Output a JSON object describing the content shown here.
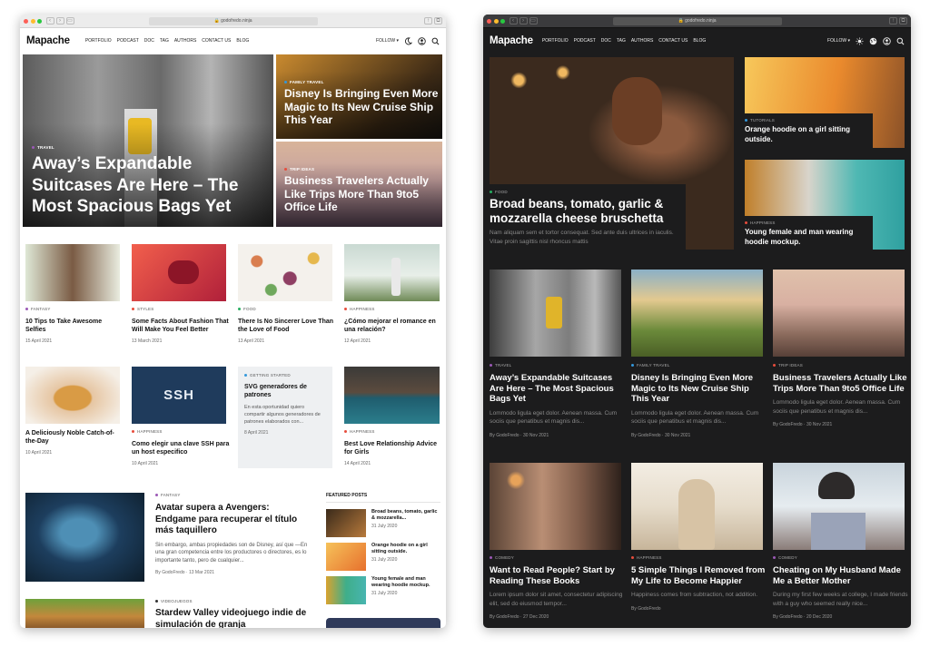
{
  "site": {
    "logo": "Mapache",
    "url": "godofredo.ninja",
    "menu": [
      "PORTFOLIO",
      "PODCAST",
      "DOC",
      "TAG",
      "AUTHORS",
      "CONTACT US",
      "BLOG"
    ],
    "follow": "FOLLOW"
  },
  "light": {
    "hero": {
      "tag": "TRAVEL",
      "title": "Away’s Expandable Suitcases Are Here – The Most Spacious Bags Yet"
    },
    "side1": {
      "tag": "FAMILY TRAVEL",
      "title": "Disney Is Bringing Even More Magic to Its New Cruise Ship This Year"
    },
    "side2": {
      "tag": "TRIP IDEAS",
      "title": "Business Travelers Actually Like Trips More Than 9to5 Office Life"
    },
    "cards": [
      {
        "tag": "FANTASY",
        "title": "10 Tips to Take Awesome Selfies",
        "date": "15 April 2021",
        "color": "#9b59b6"
      },
      {
        "tag": "STYLES",
        "title": "Some Facts About Fashion That Will Make You Feel Better",
        "date": "13 March 2021",
        "color": "#e74c3c"
      },
      {
        "tag": "FOOD",
        "title": "There Is No Sincerer Love Than the Love of Food",
        "date": "13 April 2021",
        "color": "#27ae60"
      },
      {
        "tag": "HAPPINESS",
        "title": "¿Cómo mejorar el romance en una relación?",
        "date": "12 April 2021",
        "color": "#e74c3c"
      },
      {
        "tag": "",
        "title": "A Deliciously Noble Catch-of-the-Day",
        "date": "10 April 2021",
        "color": "#27ae60"
      },
      {
        "tag": "HAPPINESS",
        "title": "Como elegir una clave SSH para un host especifico",
        "date": "10 April 2021",
        "color": "#e74c3c"
      },
      {
        "tag": "GETTING STARTED",
        "title": "SVG generadores de patrones",
        "excerpt": "En esta oportunidad quiero compartir algunos generadores de patrones elaborados con...",
        "date": "8 April 2021",
        "color": "#3498db"
      },
      {
        "tag": "HAPPINESS",
        "title": "Best Love Relationship Advice for Girls",
        "date": "14 April 2021",
        "color": "#e74c3c"
      }
    ],
    "ssh_label": "SSH",
    "list1": {
      "tag": "FANTASY",
      "title": "Avatar supera a Avengers: Endgame para recuperar el título más taquillero",
      "excerpt": "Sin embargo, ambas propiedades son de Disney, así que —En una gran competencia entre los productores o directores, es lo importante tanto, pero de cualquier...",
      "author": "By GodoFredo",
      "date": "13 Mar 2021"
    },
    "list2": {
      "tag": "VIDEOJUEGOS",
      "title": "Stardew Valley videojuego indie de simulación de granja"
    },
    "featured": {
      "heading": "FEATURED POSTS",
      "items": [
        {
          "title": "Broad beans, tomato, garlic & mozzarella...",
          "date": "31 July 2020"
        },
        {
          "title": "Orange hoodie on a girl sitting outside.",
          "date": "31 July 2020"
        },
        {
          "title": "Young female and man wearing hoodie mockup.",
          "date": "31 July 2020"
        }
      ]
    }
  },
  "dark": {
    "hero": {
      "tag": "FOOD",
      "title": "Broad beans, tomato, garlic & mozzarella cheese bruschetta",
      "excerpt": "Nam aliquam sem et tortor consequat. Sed ante duis ultrices in iaculis. Vitae proin sagittis nisl rhoncus mattis"
    },
    "side1": {
      "tag": "TUTORIALS",
      "title": "Orange hoodie on a girl sitting outside."
    },
    "side2": {
      "tag": "HAPPINESS",
      "title": "Young female and man wearing hoodie mockup."
    },
    "cards": [
      {
        "tag": "TRAVEL",
        "title": "Away’s Expandable Suitcases Are Here – The Most Spacious Bags Yet",
        "excerpt": "Lommodo ligula eget dolor. Aenean massa. Cum sociis que penatibus et magnis dis...",
        "author": "By GodoFredo",
        "date": "30 Nov 2021",
        "color": "#9b59b6"
      },
      {
        "tag": "FAMILY TRAVEL",
        "title": "Disney Is Bringing Even More Magic to Its New Cruise Ship This Year",
        "excerpt": "Lommodo ligula eget dolor. Aenean massa. Cum sociis que penatibus et magnis dis...",
        "author": "By GodoFredo",
        "date": "30 Nov 2021",
        "color": "#3498db"
      },
      {
        "tag": "TRIP IDEAS",
        "title": "Business Travelers Actually Like Trips More Than 9to5 Office Life",
        "excerpt": "Lommodo ligula eget dolor. Aenean massa. Cum sociis que penatibus et magnis dis...",
        "author": "By GodoFredo",
        "date": "30 Nov 2021",
        "color": "#e74c3c"
      },
      {
        "tag": "COMEDY",
        "title": "Want to Read People? Start by Reading These Books",
        "excerpt": "Lorem ipsum dolor sit amet, consectetur adipiscing elit, sed do eiusmod tempor...",
        "author": "By GodoFredo",
        "date": "27 Dec 2020",
        "color": "#9b59b6"
      },
      {
        "tag": "HAPPINESS",
        "title": "5 Simple Things I Removed from My Life to Become Happier",
        "excerpt": "Happiness comes from subtraction, not addition.",
        "author": "By GodoFredo",
        "date": "",
        "color": "#e74c3c"
      },
      {
        "tag": "COMEDY",
        "title": "Cheating on My Husband Made Me a Better Mother",
        "excerpt": "During my first few weeks at college, I made friends with a guy who seemed really nice...",
        "author": "By GodoFredo",
        "date": "20 Dec 2020",
        "color": "#9b59b6"
      }
    ]
  }
}
